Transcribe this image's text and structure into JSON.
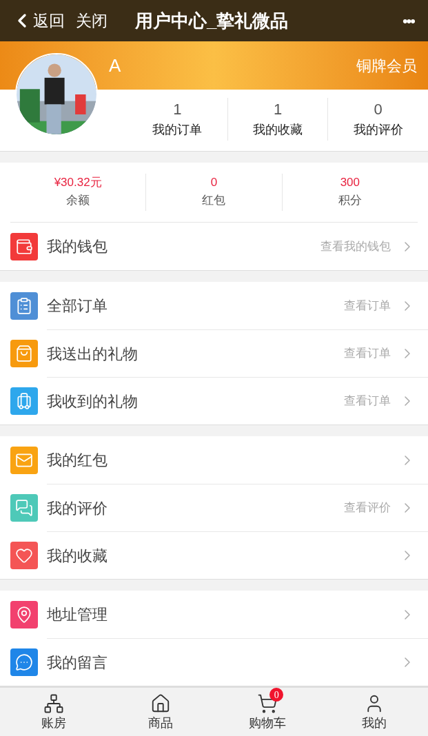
{
  "nav_bar": {
    "back": "返回",
    "close": "关闭",
    "title": "用户中心_挚礼微品",
    "more": "•••"
  },
  "profile": {
    "name": "A",
    "level": "铜牌会员",
    "stats": [
      {
        "value": "1",
        "label": "我的订单"
      },
      {
        "value": "1",
        "label": "我的收藏"
      },
      {
        "value": "0",
        "label": "我的评价"
      }
    ]
  },
  "assets": [
    {
      "value": "¥30.32元",
      "label": "余额"
    },
    {
      "value": "0",
      "label": "红包"
    },
    {
      "value": "300",
      "label": "积分"
    }
  ],
  "groups": [
    [
      {
        "label": "我的钱包",
        "hint": "查看我的钱包"
      }
    ],
    [
      {
        "label": "全部订单",
        "hint": "查看订单"
      },
      {
        "label": "我送出的礼物",
        "hint": "查看订单"
      },
      {
        "label": "我收到的礼物",
        "hint": "查看订单"
      }
    ],
    [
      {
        "label": "我的红包"
      },
      {
        "label": "我的评价",
        "hint": "查看评价"
      },
      {
        "label": "我的收藏"
      }
    ],
    [
      {
        "label": "地址管理"
      },
      {
        "label": "我的留言"
      }
    ]
  ],
  "tab_bar": [
    {
      "label": "账房",
      "selected": false
    },
    {
      "label": "商品",
      "selected": false
    },
    {
      "label": "购物车",
      "badge": "0",
      "selected": false
    },
    {
      "label": "我的",
      "selected": false
    }
  ]
}
